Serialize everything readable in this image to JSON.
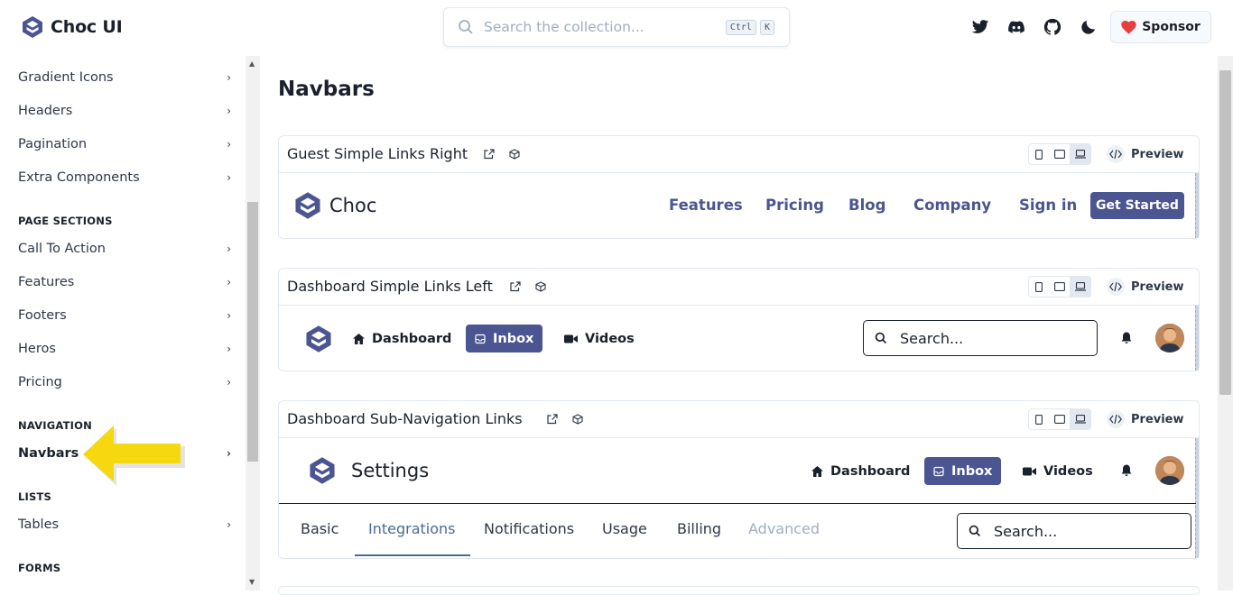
{
  "header": {
    "app_name": "Choc UI",
    "search_placeholder": "Search the collection...",
    "kbd_ctrl": "Ctrl",
    "kbd_k": "K",
    "icons": [
      "twitter-icon",
      "discord-icon",
      "github-icon",
      "moon-icon"
    ],
    "sponsor_label": "Sponsor"
  },
  "sidebar": {
    "items_top": [
      {
        "label": "Gradient Icons"
      },
      {
        "label": "Headers"
      },
      {
        "label": "Pagination"
      },
      {
        "label": "Extra Components"
      }
    ],
    "section_page": "PAGE SECTIONS",
    "items_page": [
      {
        "label": "Call To Action"
      },
      {
        "label": "Features"
      },
      {
        "label": "Footers"
      },
      {
        "label": "Heros"
      },
      {
        "label": "Pricing"
      }
    ],
    "section_navigation": "NAVIGATION",
    "item_navbars": "Navbars",
    "section_lists": "LISTS",
    "item_tables": "Tables",
    "section_forms": "FORMS",
    "chevron": "›"
  },
  "main": {
    "title": "Navbars",
    "preview_label": "Preview",
    "cards": [
      {
        "title": "Guest Simple Links Right",
        "brand": "Choc",
        "links": [
          "Features",
          "Pricing",
          "Blog",
          "Company",
          "Sign in"
        ],
        "cta": "Get Started"
      },
      {
        "title": "Dashboard Simple Links Left",
        "nav": [
          "Dashboard",
          "Inbox",
          "Videos"
        ],
        "search_placeholder": "Search..."
      },
      {
        "title": "Dashboard Sub-Navigation Links",
        "brand": "Settings",
        "nav": [
          "Dashboard",
          "Inbox",
          "Videos"
        ],
        "tabs": [
          "Basic",
          "Integrations",
          "Notifications",
          "Usage",
          "Billing",
          "Advanced"
        ],
        "active_tab": "Integrations",
        "search_placeholder": "Search..."
      }
    ]
  },
  "colors": {
    "brand": "#4a5591",
    "arrow": "#f5d80f",
    "heart": "#e53e3e"
  }
}
